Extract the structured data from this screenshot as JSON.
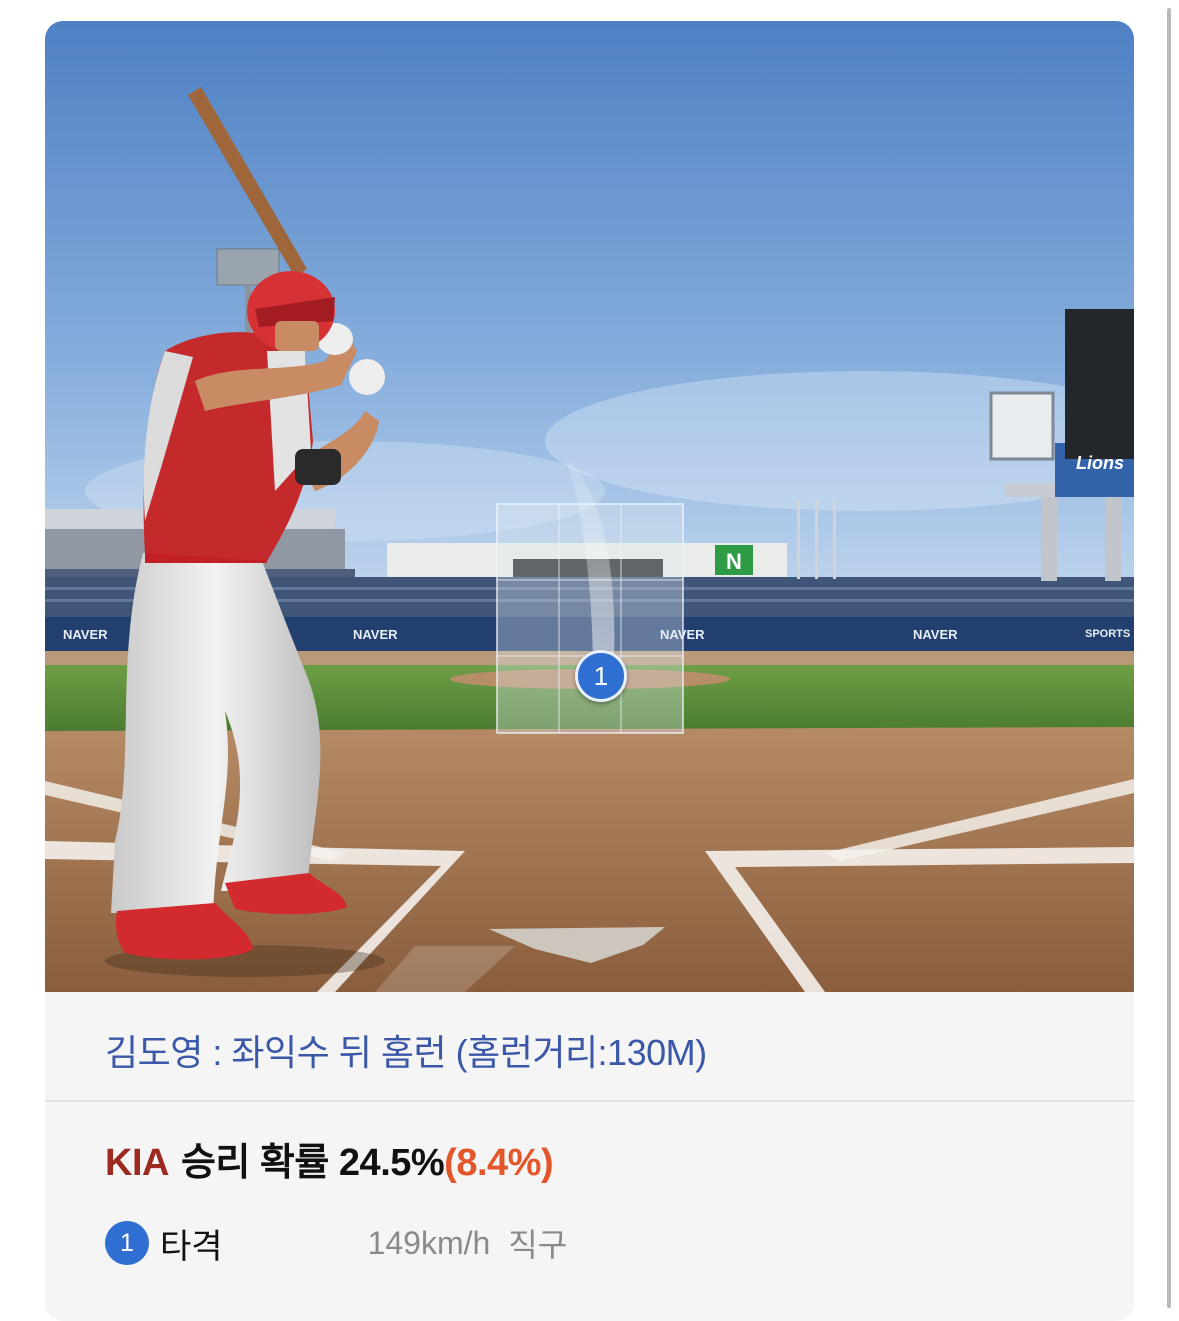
{
  "play": {
    "zone_number": "1",
    "caption": "김도영 : 좌익수 뒤 홈런 (홈런거리:130M)"
  },
  "stadium": {
    "ad_text": "NAVER",
    "ad_sports": "SPORTS",
    "sign_letter": "N",
    "scoreboard_logo": "Lions"
  },
  "win_probability": {
    "team": "KIA",
    "label": "승리 확률",
    "value": "24.5%",
    "change": "(8.4%)"
  },
  "pitch_event": {
    "number": "1",
    "type": "타격",
    "speed": "149km/h",
    "pitch": "직구"
  },
  "colors": {
    "badge": "#2f6fd1",
    "caption": "#3a57a8",
    "team": "#9d2a1f",
    "delta": "#e2562a"
  }
}
